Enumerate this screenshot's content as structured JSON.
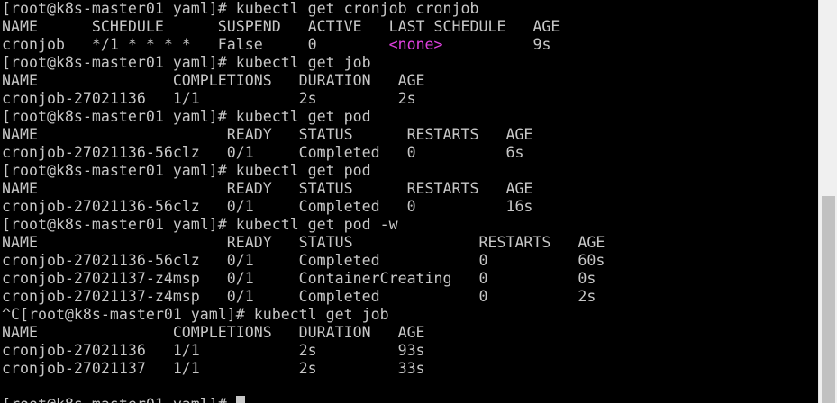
{
  "terminal": {
    "cursor_line_index": 22,
    "lines": [
      [
        {
          "t": "[root@k8s-master01 yaml]# kubectl get cronjob cronjob"
        }
      ],
      [
        {
          "t": "NAME      SCHEDULE      SUSPEND   ACTIVE   LAST SCHEDULE   AGE"
        }
      ],
      [
        {
          "t": "cronjob   */1 * * * *   False     0        "
        },
        {
          "t": "<none>",
          "c": "magenta"
        },
        {
          "t": "          9s"
        }
      ],
      [
        {
          "t": "[root@k8s-master01 yaml]# kubectl get job"
        }
      ],
      [
        {
          "t": "NAME               COMPLETIONS   DURATION   AGE"
        }
      ],
      [
        {
          "t": "cronjob-27021136   1/1           2s         2s"
        }
      ],
      [
        {
          "t": "[root@k8s-master01 yaml]# kubectl get pod"
        }
      ],
      [
        {
          "t": "NAME                     READY   STATUS      RESTARTS   AGE"
        }
      ],
      [
        {
          "t": "cronjob-27021136-56clz   0/1     Completed   0          6s"
        }
      ],
      [
        {
          "t": "[root@k8s-master01 yaml]# kubectl get pod"
        }
      ],
      [
        {
          "t": "NAME                     READY   STATUS      RESTARTS   AGE"
        }
      ],
      [
        {
          "t": "cronjob-27021136-56clz   0/1     Completed   0          16s"
        }
      ],
      [
        {
          "t": "[root@k8s-master01 yaml]# kubectl get pod -w"
        }
      ],
      [
        {
          "t": "NAME                     READY   STATUS              RESTARTS   AGE"
        }
      ],
      [
        {
          "t": "cronjob-27021136-56clz   0/1     Completed           0          60s"
        }
      ],
      [
        {
          "t": "cronjob-27021137-z4msp   0/1     ContainerCreating   0          0s"
        }
      ],
      [
        {
          "t": "cronjob-27021137-z4msp   0/1     Completed           0          2s"
        }
      ],
      [
        {
          "t": "^C[root@k8s-master01 yaml]# kubectl get job"
        }
      ],
      [
        {
          "t": "NAME               COMPLETIONS   DURATION   AGE"
        }
      ],
      [
        {
          "t": "cronjob-27021136   1/1           2s         93s"
        }
      ],
      [
        {
          "t": "cronjob-27021137   1/1           2s         33s"
        }
      ],
      [
        {
          "t": ""
        }
      ],
      [
        {
          "t": "[root@k8s-master01 yaml]# "
        }
      ]
    ]
  },
  "colors": {
    "background": "#000000",
    "foreground": "#c7c7c7",
    "magenta": "#e040e0",
    "scrollbar_track": "#f0f0f0",
    "scrollbar_thumb": "#c1c1c1"
  }
}
